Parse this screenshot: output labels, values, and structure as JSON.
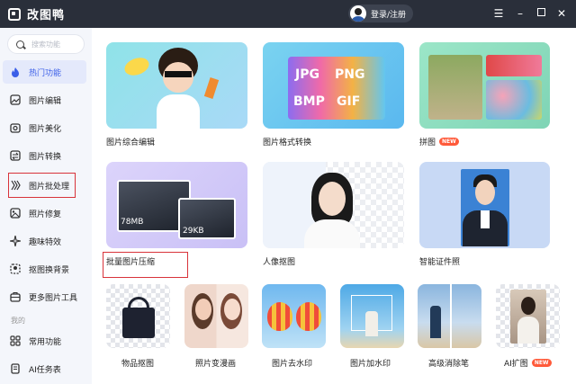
{
  "app": {
    "title": "改图鸭",
    "login_label": "登录/注册"
  },
  "search": {
    "placeholder": "搜索功能"
  },
  "sidebar": {
    "items": [
      {
        "label": "热门功能",
        "icon": "flame-icon"
      },
      {
        "label": "图片编辑",
        "icon": "image-edit-icon"
      },
      {
        "label": "图片美化",
        "icon": "image-beautify-icon"
      },
      {
        "label": "图片转换",
        "icon": "image-convert-icon"
      },
      {
        "label": "图片批处理",
        "icon": "batch-process-icon"
      },
      {
        "label": "照片修复",
        "icon": "photo-repair-icon"
      },
      {
        "label": "趣味特效",
        "icon": "sparkle-icon"
      },
      {
        "label": "抠图换背景",
        "icon": "cutout-icon"
      },
      {
        "label": "更多图片工具",
        "icon": "toolbox-icon"
      }
    ],
    "section_label": "我的",
    "my_items": [
      {
        "label": "常用功能",
        "icon": "grid-icon"
      },
      {
        "label": "AI任务表",
        "icon": "ai-task-icon"
      }
    ]
  },
  "cards": {
    "row1": [
      {
        "label": "图片综合编辑"
      },
      {
        "label": "图片格式转换",
        "formats": [
          "JPG",
          "PNG",
          "BMP",
          "GIF"
        ]
      },
      {
        "label": "拼图",
        "badge": "NEW"
      }
    ],
    "row2": [
      {
        "label": "批量图片压缩",
        "size_before": "78MB",
        "size_after": "29KB"
      },
      {
        "label": "人像抠图"
      },
      {
        "label": "智能证件照"
      }
    ],
    "row3": [
      {
        "label": "物品抠图"
      },
      {
        "label": "照片变漫画"
      },
      {
        "label": "图片去水印"
      },
      {
        "label": "图片加水印"
      },
      {
        "label": "高级消除笔"
      },
      {
        "label": "AI扩图",
        "badge": "NEW"
      }
    ]
  },
  "colors": {
    "accent": "#3a5ee8",
    "titlebar": "#2a2f3a",
    "highlight": "#d8333a",
    "badge": "#ff5a3a"
  }
}
